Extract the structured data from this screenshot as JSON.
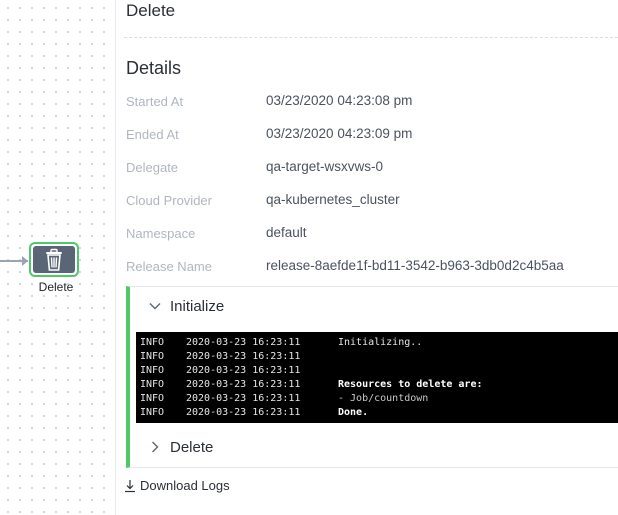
{
  "canvas": {
    "node": {
      "label": "Delete",
      "icon": "trash-icon",
      "status_color": "#4fc86a"
    }
  },
  "panel": {
    "title": "Delete",
    "details_title": "Details",
    "details": [
      {
        "label": "Started At",
        "value": "03/23/2020 04:23:08 pm"
      },
      {
        "label": "Ended At",
        "value": "03/23/2020 04:23:09 pm"
      },
      {
        "label": "Delegate",
        "value": "qa-target-wsxvws-0"
      },
      {
        "label": "Cloud Provider",
        "value": "qa-kubernetes_cluster"
      },
      {
        "label": "Namespace",
        "value": "default"
      },
      {
        "label": "Release Name",
        "value": "release-8aefde1f-bd11-3542-b963-3db0d2c4b5aa"
      }
    ],
    "sections": [
      {
        "label": "Initialize",
        "expanded": true,
        "icon": "chevron-down-icon"
      },
      {
        "label": "Delete",
        "expanded": false,
        "icon": "chevron-right-icon"
      }
    ],
    "log": [
      {
        "level": "INFO",
        "time": "2020-03-23 16:23:11",
        "message": "Initializing..",
        "style": "normal"
      },
      {
        "level": "INFO",
        "time": "2020-03-23 16:23:11",
        "message": "",
        "style": "normal"
      },
      {
        "level": "INFO",
        "time": "2020-03-23 16:23:11",
        "message": "",
        "style": "normal"
      },
      {
        "level": "INFO",
        "time": "2020-03-23 16:23:11",
        "message": "Resources to delete are:",
        "style": "bold"
      },
      {
        "level": "INFO",
        "time": "2020-03-23 16:23:11",
        "message": "- Job/countdown",
        "style": "dim"
      },
      {
        "level": "INFO",
        "time": "2020-03-23 16:23:11",
        "message": "Done.",
        "style": "bold"
      }
    ],
    "download_label": "Download Logs",
    "download_icon": "download-icon"
  },
  "colors": {
    "success": "#4fc86a",
    "log_background": "#000000",
    "label": "#b0b6c1"
  }
}
